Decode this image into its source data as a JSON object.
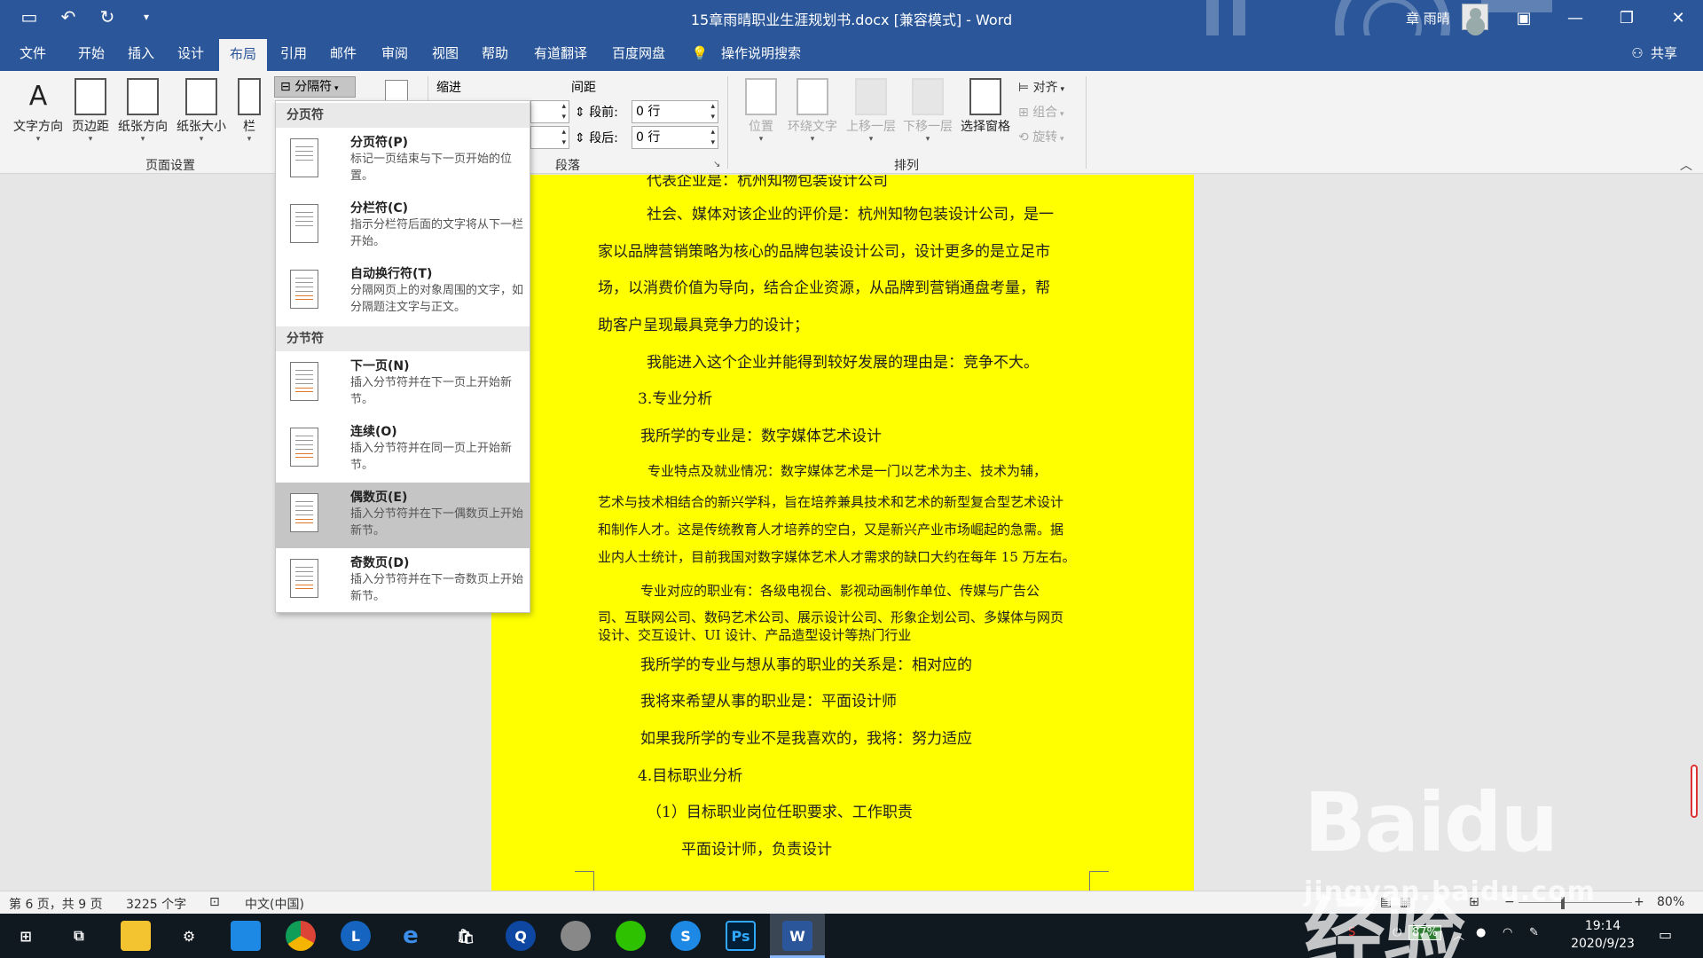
{
  "titlebar": {
    "title": "15章雨晴职业生涯规划书.docx [兼容模式] - Word",
    "user": "章 雨晴"
  },
  "tabs": [
    "文件",
    "开始",
    "插入",
    "设计",
    "布局",
    "引用",
    "邮件",
    "审阅",
    "视图",
    "帮助",
    "有道翻译",
    "百度网盘"
  ],
  "active_tab": "布局",
  "tell_me": "操作说明搜索",
  "share": "共享",
  "ribbon": {
    "page_setup": {
      "buttons": [
        "文字方向",
        "页边距",
        "纸张方向",
        "纸张大小",
        "栏"
      ],
      "breaks_label": "分隔符",
      "group_label": "页面设置"
    },
    "paragraph": {
      "indent_label": "缩进",
      "spacing_label": "间距",
      "before_label": "段前:",
      "before_value": "0 行",
      "after_label": "段后:",
      "after_value": "0 行",
      "group_label": "段落"
    },
    "arrange": {
      "buttons": [
        "位置",
        "环绕文字",
        "上移一层",
        "下移一层",
        "选择窗格"
      ],
      "align": "对齐",
      "group": "组合",
      "rotate": "旋转",
      "group_label": "排列"
    }
  },
  "breaks_menu": {
    "page_breaks_header": "分页符",
    "section_breaks_header": "分节符",
    "items": [
      {
        "title": "分页符(P)",
        "desc": "标记一页结束与下一页开始的位置。"
      },
      {
        "title": "分栏符(C)",
        "desc": "指示分栏符后面的文字将从下一栏开始。"
      },
      {
        "title": "自动换行符(T)",
        "desc": "分隔网页上的对象周围的文字，如分隔题注文字与正文。"
      },
      {
        "title": "下一页(N)",
        "desc": "插入分节符并在下一页上开始新节。"
      },
      {
        "title": "连续(O)",
        "desc": "插入分节符并在同一页上开始新节。"
      },
      {
        "title": "偶数页(E)",
        "desc": "插入分节符并在下一偶数页上开始新节。"
      },
      {
        "title": "奇数页(D)",
        "desc": "插入分节符并在下一奇数页上开始新节。"
      }
    ]
  },
  "document": {
    "lines": [
      "代表企业是：杭州知物包装设计公司",
      "社会、媒体对该企业的评价是：杭州知物包装设计公司，是一",
      "家以品牌营销策略为核心的品牌包装设计公司，设计更多的是立足市",
      "场，以消费价值为导向，结合企业资源，从品牌到营销通盘考量，帮",
      "助客户呈现最具竞争力的设计；",
      "我能进入这个企业并能得到较好发展的理由是：竞争不大。",
      "3.专业分析",
      "我所学的专业是：数字媒体艺术设计",
      "专业特点及就业情况：数字媒体艺术是一门以艺术为主、技术为辅，",
      "艺术与技术相结合的新兴学科，旨在培养兼具技术和艺术的新型复合型艺术设计",
      "和制作人才。这是传统教育人才培养的空白，又是新兴产业市场崛起的急需。据",
      "业内人士统计，目前我国对数字媒体艺术人才需求的缺口大约在每年 15 万左右。",
      "专业对应的职业有：各级电视台、影视动画制作单位、传媒与广告公",
      "司、互联网公司、数码艺术公司、展示设计公司、形象企划公司、多媒体与网页",
      "设计、交互设计、UI 设计、产品造型设计等热门行业",
      "我所学的专业与想从事的职业的关系是：相对应的",
      "我将来希望从事的职业是：平面设计师",
      "如果我所学的专业不是我喜欢的，我将：努力适应",
      "4.目标职业分析",
      "（1）目标职业岗位任职要求、工作职责",
      "平面设计师，负责设计"
    ]
  },
  "statusbar": {
    "page": "第 6 页，共 9 页",
    "words": "3225 个字",
    "language": "中文(中国)",
    "zoom": "80%"
  },
  "taskbar": {
    "battery": "87%",
    "time": "19:14",
    "date": "2020/9/23"
  },
  "watermark": {
    "brand": "Baidu经验",
    "url": "jingyan.baidu.com"
  },
  "colors": {
    "brand": "#2b579a",
    "page_highlight": "#ffff00",
    "menu_highlight": "#c5c5c5"
  }
}
